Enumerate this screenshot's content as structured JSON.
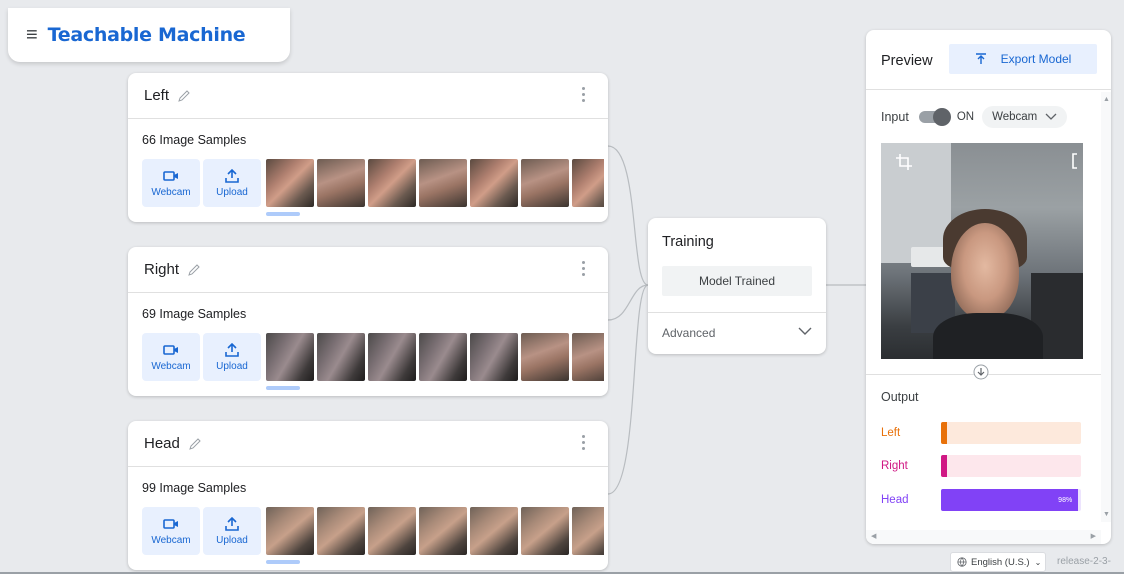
{
  "app": {
    "title": "Teachable Machine",
    "menu_icon": "hamburger-menu-icon"
  },
  "classes": [
    {
      "name": "Left",
      "samples": "66 Image Samples",
      "webcam_label": "Webcam",
      "upload_label": "Upload"
    },
    {
      "name": "Right",
      "samples": "69 Image Samples",
      "webcam_label": "Webcam",
      "upload_label": "Upload"
    },
    {
      "name": "Head",
      "samples": "99 Image Samples",
      "webcam_label": "Webcam",
      "upload_label": "Upload"
    }
  ],
  "training": {
    "title": "Training",
    "button_label": "Model Trained",
    "advanced_label": "Advanced"
  },
  "preview": {
    "title": "Preview",
    "export_label": "Export Model",
    "input_label": "Input",
    "toggle_state": "ON",
    "source_select": "Webcam",
    "output_label": "Output",
    "outputs": [
      {
        "label": "Left",
        "color": "#e8710a",
        "bg": "#fde9dc",
        "percent": 1,
        "percent_text": ""
      },
      {
        "label": "Right",
        "color": "#d01884",
        "bg": "#fde7ec",
        "percent": 0,
        "percent_text": ""
      },
      {
        "label": "Head",
        "color": "#8142f6",
        "bg": "#ede4fe",
        "percent": 98,
        "percent_text": "98%"
      }
    ]
  },
  "footer": {
    "language": "English (U.S.)",
    "release": "release-2-3-"
  },
  "colors": {
    "accent": "#1967d2",
    "accent_bg": "#e8f0fe",
    "background": "#e8eaed"
  }
}
